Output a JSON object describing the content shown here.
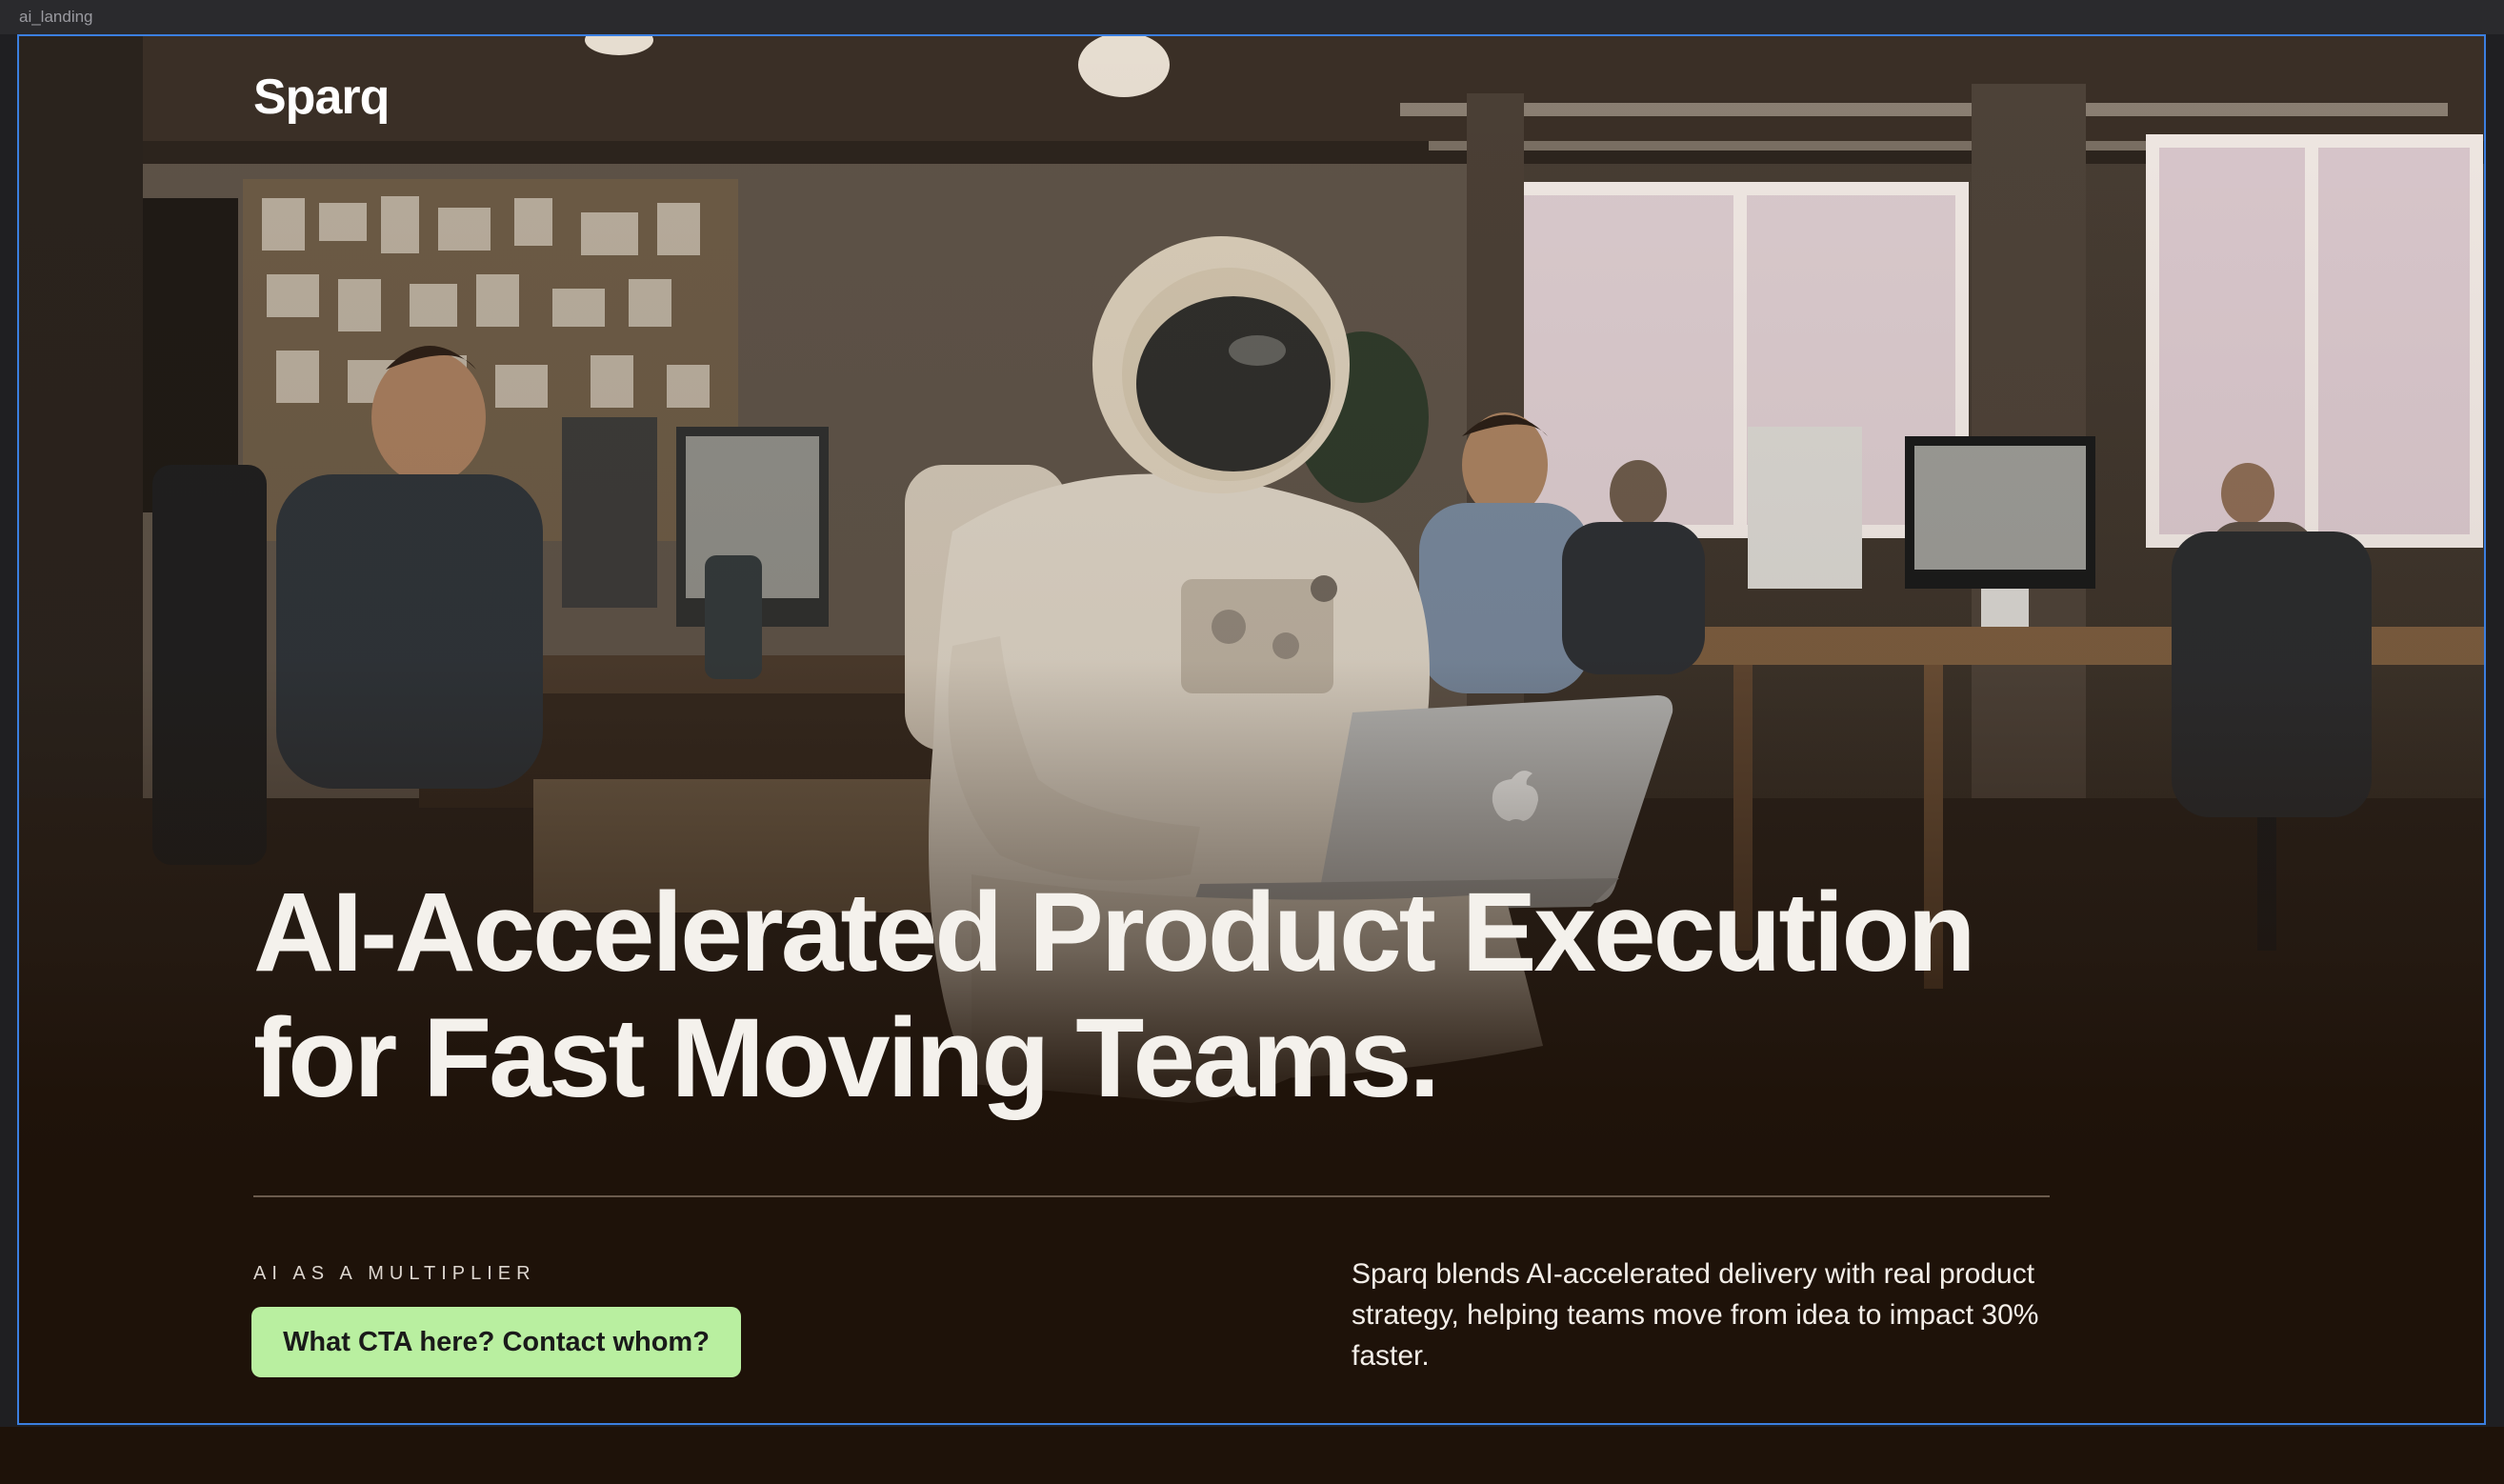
{
  "window": {
    "frame_label": "ai_landing"
  },
  "header": {
    "brand": "Sparq"
  },
  "hero": {
    "headline_line1": "AI-Accelerated Product Execution",
    "headline_line2": "for Fast Moving Teams.",
    "eyebrow": "AI AS A MULTIPLIER",
    "cta_label": "What CTA here? Contact whom?",
    "description": "Sparq blends AI-accelerated delivery with real product strategy, helping teams move from idea to impact 30% faster.",
    "background_image": "astronaut-office-photo"
  },
  "colors": {
    "accent": "#b9efa0",
    "page_background": "#1e1209",
    "selection_outline": "#3b7fe0"
  }
}
